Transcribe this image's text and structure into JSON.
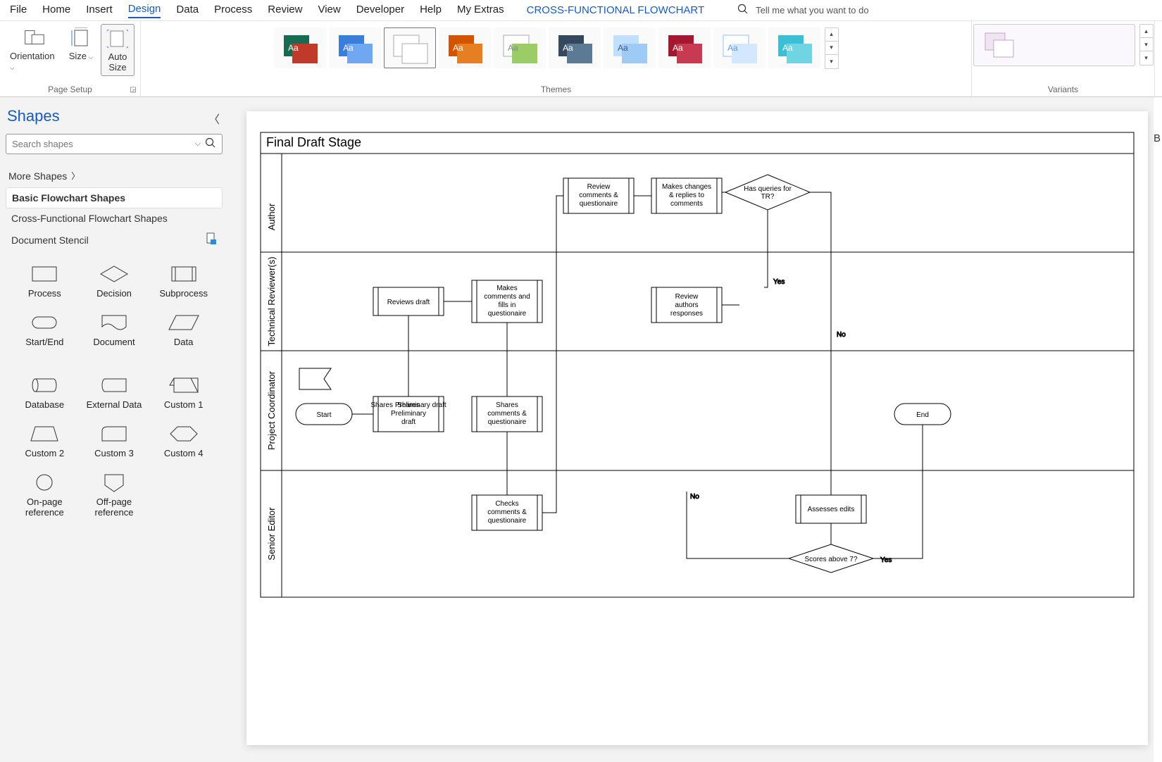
{
  "tabs": {
    "file": "File",
    "home": "Home",
    "insert": "Insert",
    "design": "Design",
    "data": "Data",
    "process": "Process",
    "review": "Review",
    "view": "View",
    "developer": "Developer",
    "help": "Help",
    "extras": "My Extras",
    "tool_tab": "CROSS-FUNCTIONAL FLOWCHART",
    "tellme_placeholder": "Tell me what you want to do"
  },
  "ribbon": {
    "orientation": "Orientation",
    "size": "Size",
    "auto_size": "Auto\nSize",
    "page_setup": "Page Setup",
    "themes": "Themes",
    "variants": "Variants"
  },
  "sidepanel": {
    "title": "Shapes",
    "search_placeholder": "Search shapes",
    "more_shapes": "More Shapes",
    "stencils": {
      "basic": "Basic Flowchart Shapes",
      "cross": "Cross-Functional Flowchart Shapes",
      "document": "Document Stencil"
    },
    "shapes": {
      "process": "Process",
      "decision": "Decision",
      "subprocess": "Subprocess",
      "start_end": "Start/End",
      "document": "Document",
      "data": "Data",
      "database": "Database",
      "external": "External Data",
      "custom1": "Custom 1",
      "custom2": "Custom 2",
      "custom3": "Custom 3",
      "custom4": "Custom 4",
      "onpage": "On-page reference",
      "offpage": "Off-page reference"
    }
  },
  "flowchart": {
    "title": "Final Draft Stage",
    "lanes": {
      "author": "Author",
      "tr": "Technical Reviewer(s)",
      "pc": "Project Coordinator",
      "se": "Senior Editor"
    },
    "nodes": {
      "start": "Start",
      "share_prelim": "Shares Preliminary draft",
      "reviews_draft": "Reviews draft",
      "makes_fills": "Makes comments and fills in questionaire",
      "shares_cq": "Shares comments & questionaire",
      "checks_cq": "Checks comments & questionaire",
      "review_cq": "Review comments & questionaire",
      "makes_changes": "Makes changes & replies to comments",
      "has_queries": "Has queries for TR?",
      "review_auth": "Review authors responses",
      "assesses": "Assesses edits",
      "scores": "Scores above 7?",
      "end": "End"
    },
    "labels": {
      "yes": "Yes",
      "no": "No"
    }
  },
  "right_edge_letter": "B"
}
